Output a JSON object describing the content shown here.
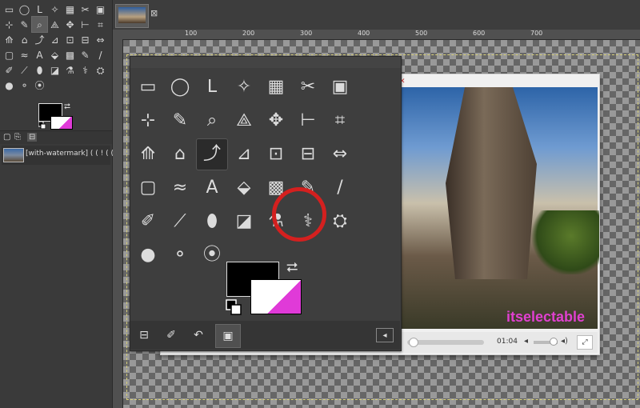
{
  "left_toolbox": {
    "tools": [
      "▭",
      "◯",
      "ᒪ",
      "✧",
      "▦",
      "✂",
      "▣",
      "⊹",
      "✎",
      "⌕",
      "⟁",
      "✥",
      "⊢",
      "⌗",
      "⟰",
      "⌂",
      "⤴",
      "⊿",
      "⊡",
      "⊟",
      "⇔",
      "▢",
      "≈",
      "A",
      "⬙",
      "▩",
      "✎",
      "/",
      "✐",
      "⟋",
      "⬮",
      "◪",
      "⚗",
      "⚕",
      "⛭",
      "●",
      "⚬",
      "⦿",
      "",
      "",
      "",
      ""
    ],
    "tool_icons": [
      "rect-select-icon",
      "ellipse-select-icon",
      "free-select-icon",
      "fuzzy-select-icon",
      "color-select-icon",
      "scissors-icon",
      "foreground-select-icon",
      "paths-icon",
      "color-picker-icon",
      "zoom-icon",
      "measure-icon",
      "move-icon",
      "align-icon",
      "crop-icon",
      "rotate-icon",
      "scale-icon",
      "shear-icon",
      "perspective-icon",
      "3d-transform-icon",
      "flip-icon",
      "cage-icon",
      "warp-icon",
      "wave-icon",
      "text-icon",
      "bucket-fill-icon",
      "gradient-icon",
      "pencil-icon",
      "paintbrush-icon",
      "eraser-icon",
      "airbrush-icon",
      "ink-icon",
      "mypaint-icon",
      "clone-icon",
      "heal-icon",
      "perspective-clone-icon",
      "blur-icon",
      "smudge-icon",
      "dodge-icon",
      "",
      "",
      "",
      ""
    ],
    "active_index": 9
  },
  "layers_dock": {
    "tabs": [
      "▢",
      "⎘",
      "⊟"
    ],
    "layer_name": "[with-watermark] ( ( ! ( ( ,( ( )"
  },
  "image_tab": {
    "close_symbol": "⊠"
  },
  "ruler": {
    "labels": [
      "100",
      "200",
      "300",
      "400",
      "500",
      "600",
      "700"
    ]
  },
  "video": {
    "watermark": "itselectable",
    "time": "01:04",
    "fullscreen_symbol": "⤢",
    "volume_symbol": "◂",
    "volume_symbol2": "◂)",
    "close_symbol": "✕"
  },
  "big_toolbox": {
    "tools": [
      "▭",
      "◯",
      "ᒪ",
      "✧",
      "▦",
      "✂",
      "▣",
      "",
      "⊹",
      "✎",
      "⌕",
      "⟁",
      "✥",
      "⊢",
      "⌗",
      "",
      "⟰",
      "⌂",
      "⤴",
      "⊿",
      "⊡",
      "⊟",
      "⇔",
      "",
      "▢",
      "≈",
      "A",
      "⬙",
      "▩",
      "✎",
      "/",
      "",
      "✐",
      "⟋",
      "⬮",
      "◪",
      "⚗",
      "⚕",
      "⛭",
      "",
      "●",
      "⚬",
      "⦿",
      "",
      "",
      "",
      "",
      ""
    ],
    "tool_icons": [
      "rect-select-icon",
      "ellipse-select-icon",
      "free-select-icon",
      "fuzzy-select-icon",
      "color-select-icon",
      "scissors-icon",
      "foreground-select-icon",
      "",
      "paths-icon",
      "color-picker-icon",
      "zoom-icon",
      "measure-icon",
      "move-icon",
      "align-icon",
      "crop-icon",
      "",
      "rotate-icon",
      "scale-icon",
      "shear-icon",
      "perspective-icon",
      "3d-transform-icon",
      "flip-icon",
      "cage-icon",
      "",
      "warp-icon",
      "wave-icon",
      "text-icon",
      "bucket-fill-icon",
      "gradient-icon",
      "pencil-icon",
      "paintbrush-icon",
      "",
      "eraser-icon",
      "airbrush-icon",
      "ink-icon",
      "mypaint-icon",
      "clone-icon",
      "heal-icon",
      "perspective-clone-icon",
      "",
      "blur-icon",
      "smudge-icon",
      "dodge-icon",
      "",
      "",
      "",
      "",
      ""
    ],
    "active_index": 18,
    "highlighted_tool": "clone-icon",
    "tabs": [
      "⊟",
      "✐",
      "↶",
      "▣"
    ],
    "expand_symbol": "◂"
  },
  "colors": {
    "foreground": "#000000",
    "background": "#ffffff",
    "accent_magenta": "#e040d0",
    "highlight_circle": "#d4201f"
  }
}
